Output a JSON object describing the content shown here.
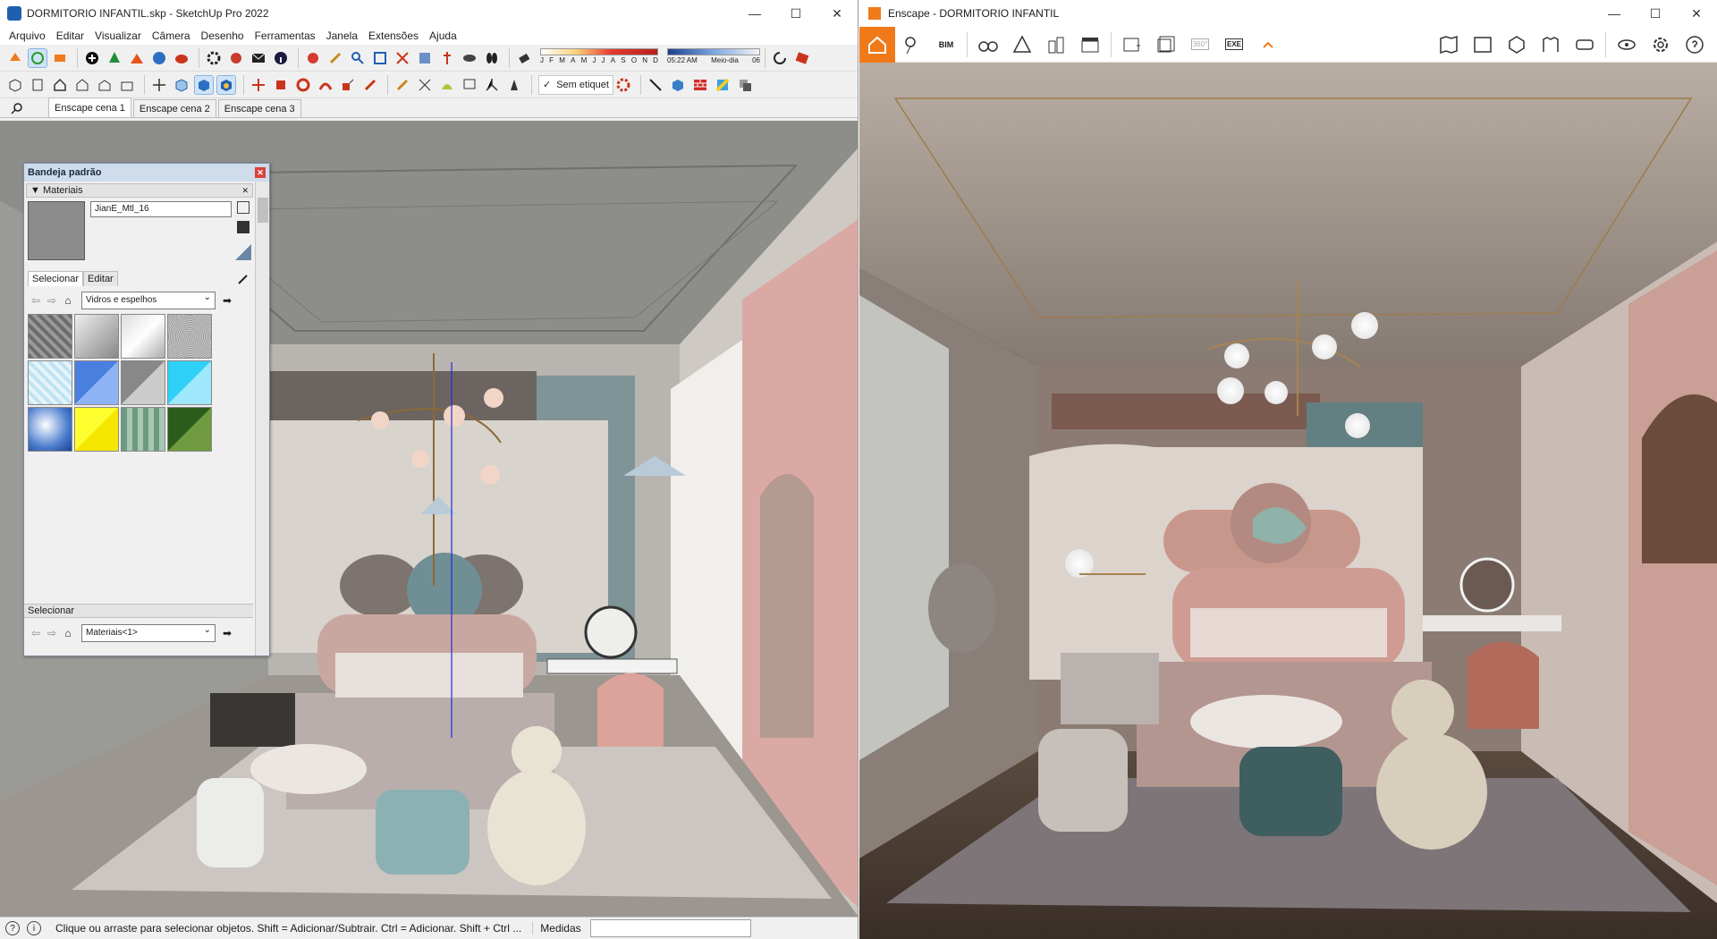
{
  "sketchup": {
    "window_title": "DORMITORIO INFANTIL.skp - SketchUp Pro 2022",
    "window_controls": [
      "—",
      "☐",
      "✕"
    ],
    "menu": [
      "Arquivo",
      "Editar",
      "Visualizar",
      "Câmera",
      "Desenho",
      "Ferramentas",
      "Janela",
      "Extensões",
      "Ajuda"
    ],
    "shadow_months": [
      "J",
      "F",
      "M",
      "A",
      "M",
      "J",
      "J",
      "A",
      "S",
      "O",
      "N",
      "D"
    ],
    "time_start": "05:22 AM",
    "time_mid": "Meio-dia",
    "time_end": "06",
    "tag_label": "Sem etiquet",
    "scene_tabs": [
      "Enscape cena 1",
      "Enscape cena 2",
      "Enscape cena 3"
    ],
    "tray": {
      "title": "Bandeja padrão",
      "section": "Materiais",
      "material_name": "JianE_Mtl_16",
      "tabs": [
        "Selecionar",
        "Editar"
      ],
      "library": "Vidros e espelhos",
      "select_section": "Selecionar",
      "select_library": "Materiais<1>"
    },
    "status": {
      "message": "Clique ou arraste para selecionar objetos. Shift = Adicionar/Subtrair. Ctrl = Adicionar. Shift + Ctrl ...",
      "measure_label": "Medidas"
    }
  },
  "enscape": {
    "window_title": "Enscape - DORMITORIO INFANTIL",
    "window_controls": [
      "—",
      "☐",
      "✕"
    ],
    "toolbar_labels": {
      "bim": "BIM",
      "pano": "360°",
      "exe": "EXE"
    },
    "accent": "#f07a1a"
  }
}
